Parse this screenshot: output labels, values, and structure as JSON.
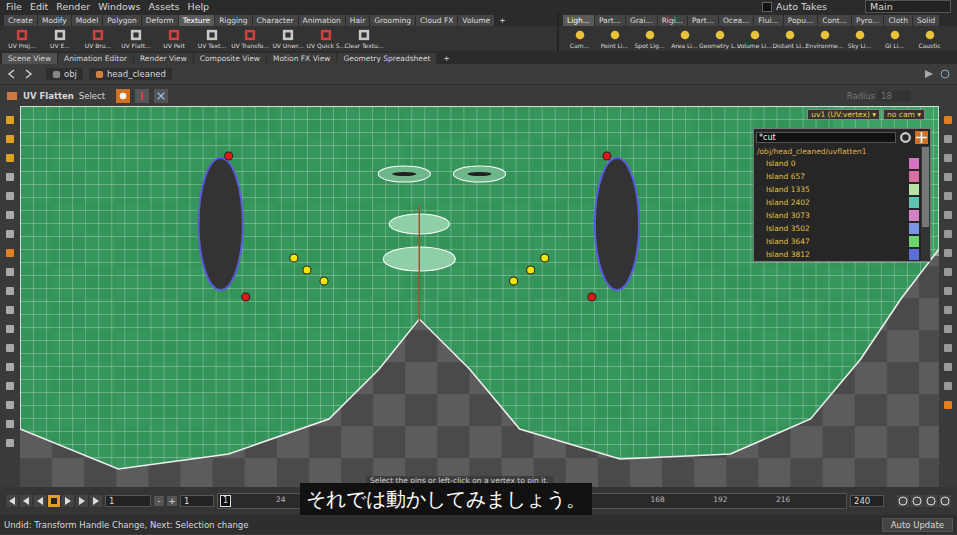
{
  "menu": [
    "File",
    "Edit",
    "Render",
    "Windows",
    "Assets",
    "Help"
  ],
  "auto_takes": {
    "label": "Auto Takes",
    "checked": false
  },
  "desktop": "Main",
  "shelf_tabs": [
    {
      "label": "Create",
      "selected": false
    },
    {
      "label": "Modify",
      "selected": false
    },
    {
      "label": "Model",
      "selected": false
    },
    {
      "label": "Polygon",
      "selected": false
    },
    {
      "label": "Deform",
      "selected": false
    },
    {
      "label": "Texture",
      "selected": true
    },
    {
      "label": "Rigging",
      "selected": false
    },
    {
      "label": "Character",
      "selected": false
    },
    {
      "label": "Animation",
      "selected": false
    },
    {
      "label": "Hair",
      "selected": false
    },
    {
      "label": "Grooming",
      "selected": false
    },
    {
      "label": "Cloud FX",
      "selected": false
    },
    {
      "label": "Volume",
      "selected": false
    }
  ],
  "shelf_add": "+",
  "shelf_tools": [
    "UV Proj...",
    "UV E...",
    "UV Bru...",
    "UV Flatt...",
    "UV Pelt",
    "UV Text...",
    "UV Transfo...",
    "UV Unwr...",
    "UV Quick S...",
    "Clear Textu..."
  ],
  "right_shelf_tabs": [
    "Ligh...",
    "Part...",
    "Grai...",
    "Rigi...",
    "Part...",
    "Ocea...",
    "Flui...",
    "Popu...",
    "Cont...",
    "Pyro...",
    "Cloth",
    "Solid"
  ],
  "right_shelf_tools": [
    "Cam...",
    "Point Li...",
    "Spot Lig...",
    "Area Li...",
    "Geometry L...",
    "Volume Li...",
    "Distant Li...",
    "Environme...",
    "Sky Li...",
    "GI Li...",
    "Caustic"
  ],
  "pane_tabs": [
    {
      "label": "Scene View",
      "selected": true
    },
    {
      "label": "Animation Editor",
      "selected": false
    },
    {
      "label": "Render View",
      "selected": false
    },
    {
      "label": "Composite View",
      "selected": false
    },
    {
      "label": "Motion FX View",
      "selected": false
    },
    {
      "label": "Geometry Spreadsheet",
      "selected": false
    }
  ],
  "pane_add": "+",
  "path": [
    "obj",
    "head_cleaned"
  ],
  "tool": {
    "name": "UV Flatten",
    "mode": "Select",
    "radius_label": "Radius",
    "radius_value": "18",
    "radius_disabled": true
  },
  "viewport": {
    "uv_set": "uv1 (UV:vertex)",
    "camera": "no cam",
    "hint": "Select the pins or left-click on a vertex to pin it.",
    "pins": [
      {
        "color": "#f2e600"
      },
      {
        "color": "#f2e600"
      },
      {
        "color": "#f2e600"
      },
      {
        "color": "#f2e600"
      },
      {
        "color": "#f2e600"
      },
      {
        "color": "#f2e600"
      },
      {
        "color": "#e01818"
      },
      {
        "color": "#e01818"
      },
      {
        "color": "#e01818"
      },
      {
        "color": "#e01818"
      }
    ]
  },
  "islands": {
    "search": "*cut",
    "node": "/obj/head_cleaned/uvflatten1",
    "items": [
      {
        "name": "Island 0",
        "color": "#d873c4"
      },
      {
        "name": "Island 657",
        "color": "#d86fa0"
      },
      {
        "name": "Island 1335",
        "color": "#b6e2a6"
      },
      {
        "name": "Island 2402",
        "color": "#5cc4b0"
      },
      {
        "name": "Island 3073",
        "color": "#d680c6"
      },
      {
        "name": "Island 3502",
        "color": "#7a96e2"
      },
      {
        "name": "Island 3647",
        "color": "#6ed46e"
      },
      {
        "name": "Island 3812",
        "color": "#5c6fd6"
      }
    ]
  },
  "timeline": {
    "start": "1",
    "range_start": "1",
    "current": "1",
    "ticks": [
      "24",
      "168",
      "192",
      "216"
    ],
    "end": "240"
  },
  "subtitle": "それでは動かしてみましょう。",
  "status": {
    "message": "Undid: Transform Handle Change, Next: Selection change",
    "update": "Auto Update"
  }
}
